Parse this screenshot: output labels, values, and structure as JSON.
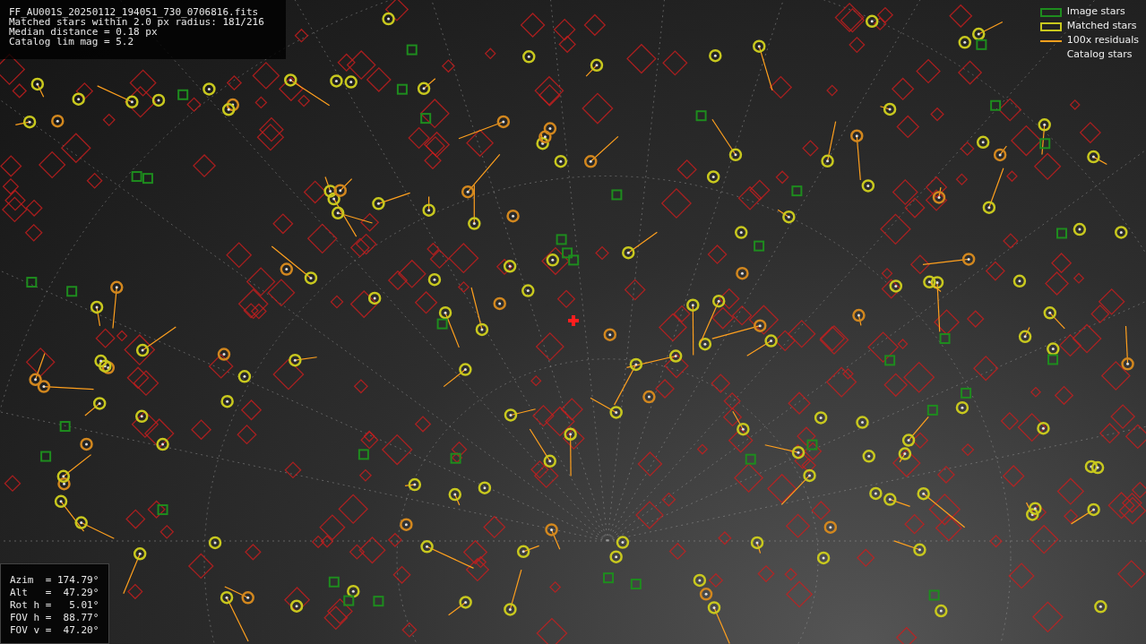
{
  "info_panel": {
    "lines": [
      "FF_AU001S_20250112_194051_730_0706816.fits",
      "Matched stars within 2.0 px radius: 181/216",
      "Median distance = 0.18 px",
      "Catalog lim mag = 5.2"
    ]
  },
  "legend": [
    {
      "label": "Image stars",
      "kind": "box",
      "color": "#1e8c1e"
    },
    {
      "label": "Matched stars",
      "kind": "box",
      "color": "#c8c81e"
    },
    {
      "label": "100x residuals",
      "kind": "line",
      "color": "#ffa01e"
    },
    {
      "label": "Catalog stars",
      "kind": "blank"
    }
  ],
  "pointing_panel": {
    "lines": [
      "Azim  = 174.79°",
      "Alt   =  47.29°",
      "Rot h =   5.01°",
      "FOV h =  88.77°",
      "FOV v =  47.20°"
    ]
  }
}
